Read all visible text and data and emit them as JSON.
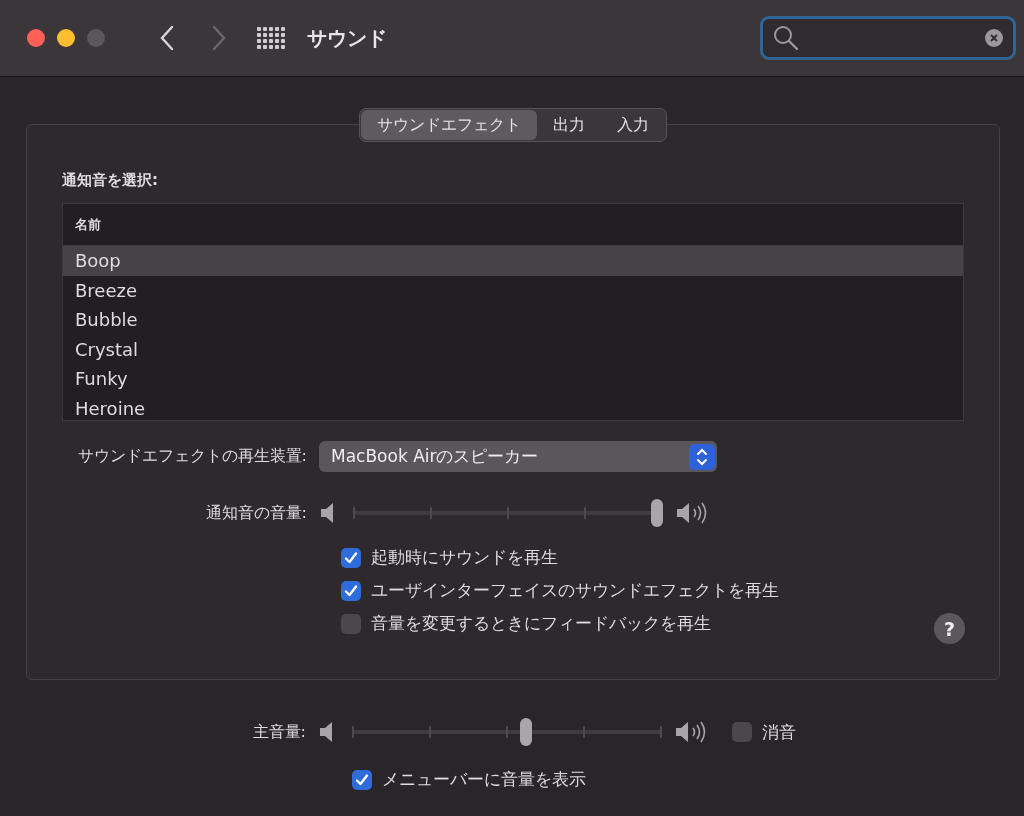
{
  "window": {
    "title": "サウンド"
  },
  "tabs": [
    {
      "label": "サウンドエフェクト",
      "selected": true
    },
    {
      "label": "出力",
      "selected": false
    },
    {
      "label": "入力",
      "selected": false
    }
  ],
  "alert_list": {
    "heading": "通知音を選択:",
    "column": "名前",
    "rows": [
      {
        "name": "Boop",
        "selected": true
      },
      {
        "name": "Breeze",
        "selected": false
      },
      {
        "name": "Bubble",
        "selected": false
      },
      {
        "name": "Crystal",
        "selected": false
      },
      {
        "name": "Funky",
        "selected": false
      },
      {
        "name": "Heroine",
        "selected": false
      }
    ]
  },
  "output_device": {
    "label": "サウンドエフェクトの再生装置:",
    "value": "MacBook Airのスピーカー"
  },
  "alert_volume": {
    "label": "通知音の音量:",
    "level": 1.0
  },
  "options": [
    {
      "label": "起動時にサウンドを再生",
      "checked": true
    },
    {
      "label": "ユーザインターフェイスのサウンドエフェクトを再生",
      "checked": true
    },
    {
      "label": "音量を変更するときにフィードバックを再生",
      "checked": false
    }
  ],
  "help": {
    "label": "?"
  },
  "output_volume": {
    "label": "主音量:",
    "level": 0.56,
    "mute": {
      "label": "消音",
      "checked": false
    }
  },
  "menubar_option": {
    "label": "メニューバーに音量を表示",
    "checked": true
  }
}
